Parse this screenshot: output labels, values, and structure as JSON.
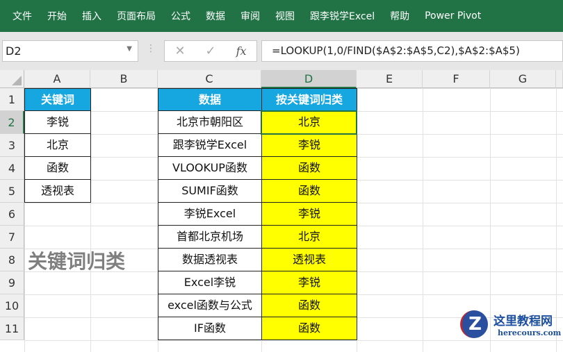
{
  "menu": [
    "文件",
    "开始",
    "插入",
    "页面布局",
    "公式",
    "数据",
    "审阅",
    "视图",
    "跟李锐学Excel",
    "帮助",
    "Power Pivot"
  ],
  "name_box": "D2",
  "formula_buttons": {
    "cancel": "✕",
    "enter": "✓",
    "fx": "fx"
  },
  "formula": "=LOOKUP(1,0/FIND($A$2:$A$5,C2),$A$2:$A$5)",
  "columns": [
    "A",
    "B",
    "C",
    "D",
    "E",
    "F",
    "G"
  ],
  "rows": [
    "1",
    "2",
    "3",
    "4",
    "5",
    "6",
    "7",
    "8",
    "9",
    "10",
    "11"
  ],
  "keywords": {
    "header": "关键词",
    "items": [
      "李锐",
      "北京",
      "函数",
      "透视表"
    ]
  },
  "data_table": {
    "headers": [
      "数据",
      "按关键词归类"
    ],
    "rows": [
      [
        "北京市朝阳区",
        "北京"
      ],
      [
        "跟李锐学Excel",
        "李锐"
      ],
      [
        "VLOOKUP函数",
        "函数"
      ],
      [
        "SUMIF函数",
        "函数"
      ],
      [
        "李锐Excel",
        "李锐"
      ],
      [
        "首都北京机场",
        "北京"
      ],
      [
        "数据透视表",
        "透视表"
      ],
      [
        "Excel李锐",
        "李锐"
      ],
      [
        "excel函数与公式",
        "函数"
      ],
      [
        "IF函数",
        "函数"
      ]
    ]
  },
  "title": "关键词归类",
  "watermark": {
    "name": "这里教程网",
    "url": "herecours.com"
  },
  "colors": {
    "ribbon": "#217346",
    "header": "#17a7e0",
    "highlight": "#ffff00"
  }
}
